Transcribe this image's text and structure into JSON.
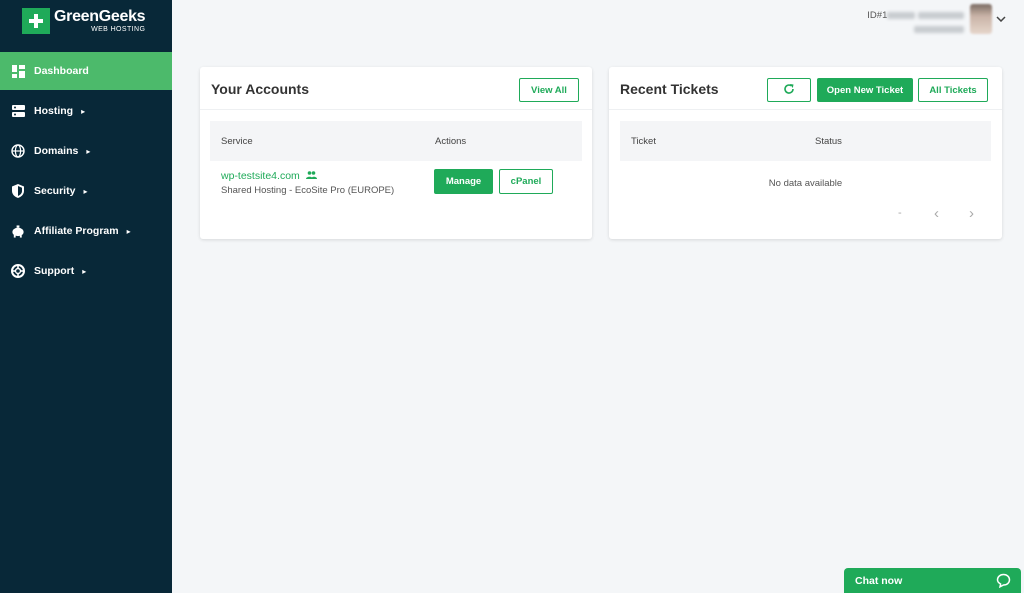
{
  "brand": {
    "name": "GreenGeeks",
    "sub": "WEB HOSTING"
  },
  "user": {
    "id_prefix": "ID#1"
  },
  "sidebar": {
    "items": [
      {
        "label": "Dashboard",
        "icon": "dashboard-icon",
        "active": true
      },
      {
        "label": "Hosting",
        "icon": "server-icon",
        "chev": "▸"
      },
      {
        "label": "Domains",
        "icon": "globe-icon",
        "chev": "▸"
      },
      {
        "label": "Security",
        "icon": "shield-icon",
        "chev": "▸"
      },
      {
        "label": "Affiliate Program",
        "icon": "piggy-bank-icon",
        "chev": "▸"
      },
      {
        "label": "Support",
        "icon": "lifebuoy-icon",
        "chev": "▸"
      }
    ]
  },
  "accounts": {
    "title": "Your Accounts",
    "view_all": "View All",
    "columns": [
      "Service",
      "Actions"
    ],
    "rows": [
      {
        "domain": "wp-testsite4.com",
        "plan": "Shared Hosting - EcoSite Pro (EUROPE)",
        "manage": "Manage",
        "cpanel": "cPanel"
      }
    ]
  },
  "tickets": {
    "title": "Recent Tickets",
    "open_new": "Open New Ticket",
    "all": "All Tickets",
    "columns": [
      "Ticket",
      "Status"
    ],
    "empty": "No data available",
    "pager_dash": "-",
    "pager_prev": "‹",
    "pager_next": "›"
  },
  "chat": {
    "label": "Chat now"
  },
  "colors": {
    "accent": "#1faa59",
    "sidebar": "#082838",
    "active": "#4cba6b"
  }
}
